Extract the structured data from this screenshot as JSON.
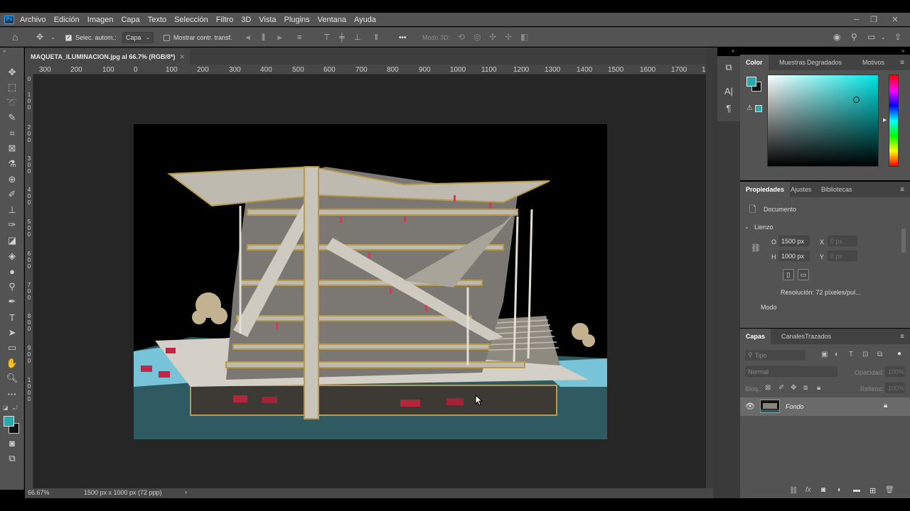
{
  "app": {
    "logo_text": "Ps"
  },
  "menubar": {
    "items": [
      "Archivo",
      "Edición",
      "Imagen",
      "Capa",
      "Texto",
      "Selección",
      "Filtro",
      "3D",
      "Vista",
      "Plugins",
      "Ventana",
      "Ayuda"
    ],
    "window_controls": {
      "minimize": "─",
      "restore": "❐",
      "close": "✕"
    }
  },
  "options_bar": {
    "auto_select_label": "Selec. autom.:",
    "auto_select_checked": true,
    "auto_select_target": "Capa",
    "show_transform_label": "Mostrar contr. transf.",
    "show_transform_checked": false,
    "mode_3d_label": "Modo 3D:",
    "more_label": "•••"
  },
  "document": {
    "tab_title": "MAQUETA_ILUMINACION.jpg al 66.7% (RGB/8*)",
    "tab_close": "✕",
    "ruler_h": [
      "300",
      "200",
      "100",
      "0",
      "100",
      "200",
      "300",
      "400",
      "500",
      "600",
      "700",
      "800",
      "900",
      "1000",
      "1100",
      "1200",
      "1300",
      "1400",
      "1500",
      "1600",
      "1700",
      "1"
    ],
    "ruler_v": [
      "0",
      "1\n0\n0",
      "2\n0\n0",
      "3\n0\n0",
      "4\n0\n0",
      "5\n0\n0",
      "6\n0\n0",
      "7\n0\n0",
      "8\n0\n0",
      "9\n0\n0",
      "1\n0\n0\n0"
    ],
    "zoom": "66.67%",
    "doc_info": "1500 px x 1000 px (72 ppp)",
    "status_arrow": "›"
  },
  "color_panel": {
    "tabs": [
      "Color",
      "Muestras",
      "Degradados",
      "Motivos"
    ],
    "foreground": "#2aa9a9",
    "background": "#111111",
    "hue_color": "#00e5e5"
  },
  "properties_panel": {
    "tabs": [
      "Propiedades",
      "Ajustes",
      "Bibliotecas"
    ],
    "doc_label": "Documento",
    "section": "Lienzo",
    "width_label": "O",
    "width_value": "1500 px",
    "height_label": "H",
    "height_value": "1000 px",
    "x_label": "X",
    "x_value": "0 px",
    "y_label": "Y",
    "y_value": "0 px",
    "resolution": "Resolución: 72 píxeles/pul...",
    "mode_label": "Modo"
  },
  "layers_panel": {
    "tabs": [
      "Capas",
      "Canales",
      "Trazados"
    ],
    "search_placeholder": "Tipo",
    "blend_mode": "Normal",
    "opacity_label": "Opacidad:",
    "opacity_value": "100%",
    "lock_label": "Bloq.:",
    "fill_label": "Relleno:",
    "fill_value": "100%",
    "layers": [
      {
        "name": "Fondo",
        "visible": true,
        "locked": true
      }
    ]
  }
}
